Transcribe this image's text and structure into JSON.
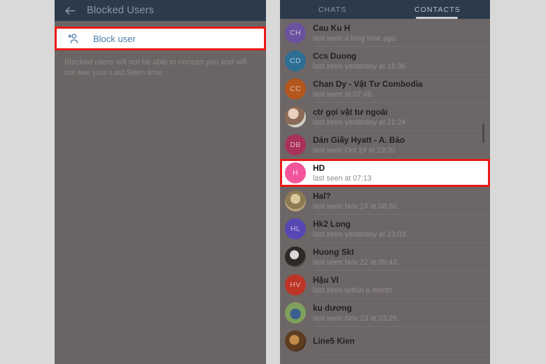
{
  "left_panel": {
    "header": {
      "back_icon": "back-arrow-icon",
      "title": "Blocked Users"
    },
    "block_user": {
      "icon": "add-person-icon",
      "label": "Block user"
    },
    "description": "Blocked users will not be able to contact you and will not see your Last Seen time."
  },
  "right_panel": {
    "tabs": [
      {
        "label": "CHATS",
        "active": false
      },
      {
        "label": "CONTACTS",
        "active": true
      }
    ],
    "contacts": [
      {
        "name": "Cau Ku H",
        "status": "last seen a long time ago",
        "initials": "CH",
        "color": "#6b529e",
        "photo": false,
        "highlighted": false
      },
      {
        "name": "Ccs Duong",
        "status": "last seen yesterday at 16:36",
        "initials": "CD",
        "color": "#2d6e94",
        "photo": false,
        "highlighted": false
      },
      {
        "name": "Chan Dy - Vật Tư Combodia",
        "status": "last seen at 07:46",
        "initials": "CC",
        "color": "#b4561e",
        "photo": false,
        "highlighted": false
      },
      {
        "name": "ctr gọi vật tư ngoài",
        "status": "last seen yesterday at 21:24",
        "initials": "",
        "color": "#cfc3bb",
        "photo": true,
        "highlighted": false
      },
      {
        "name": "Dán Giấy Hyatt - A. Bảo",
        "status": "last seen Oct 19 at 19:20",
        "initials": "DB",
        "color": "#a8325c",
        "photo": false,
        "highlighted": false
      },
      {
        "name": "HD",
        "status": "last seen at 07:13",
        "initials": "H",
        "color": "#f2559a",
        "photo": false,
        "highlighted": true
      },
      {
        "name": "Hal?",
        "status": "last seen Nov 24 at 08:50",
        "initials": "",
        "color": "#8d8455",
        "photo": true,
        "highlighted": false
      },
      {
        "name": "Hk2 Long",
        "status": "last seen yesterday at 23:03",
        "initials": "HL",
        "color": "#5747b5",
        "photo": false,
        "highlighted": false
      },
      {
        "name": "Huong Skt",
        "status": "last seen Nov 22 at 09:43",
        "initials": "",
        "color": "#413c3a",
        "photo": true,
        "highlighted": false
      },
      {
        "name": "Hậu VI",
        "status": "last seen within a month",
        "initials": "HV",
        "color": "#bc3426",
        "photo": false,
        "highlighted": false
      },
      {
        "name": "ku dương",
        "status": "last seen Nov 23 at 23:26",
        "initials": "",
        "color": "#6f8a4e",
        "photo": true,
        "highlighted": false
      },
      {
        "name": "Line5 Kien",
        "status": "",
        "initials": "",
        "color": "#6b4a2c",
        "photo": true,
        "highlighted": false
      }
    ],
    "scrollbar": {
      "name": "contacts-scrollbar"
    }
  },
  "colors": {
    "header_bar": "#2c3a4c",
    "annotation_red": "#e81a1a",
    "accent_blue": "#4b7da8",
    "panel_overlay": "#6a6565",
    "page_background": "#d9d9d9"
  }
}
